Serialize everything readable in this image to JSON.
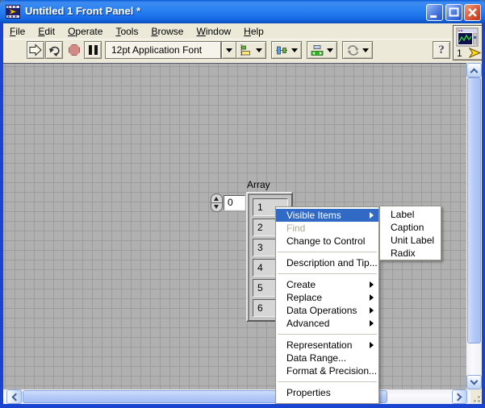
{
  "window": {
    "title": "Untitled 1 Front Panel *"
  },
  "menu_bar": {
    "items": [
      {
        "label": "File"
      },
      {
        "label": "Edit"
      },
      {
        "label": "Operate"
      },
      {
        "label": "Tools"
      },
      {
        "label": "Browse"
      },
      {
        "label": "Window"
      },
      {
        "label": "Help"
      }
    ]
  },
  "toolbar": {
    "font_selector": {
      "value": "12pt Application Font"
    },
    "help_label": "?",
    "panel_number": "1"
  },
  "panel": {
    "array": {
      "label": "Array",
      "index_value": "0",
      "elements": [
        "1",
        "2",
        "3",
        "4",
        "5",
        "6"
      ]
    }
  },
  "context_menu": {
    "items": [
      {
        "label": "Visible Items",
        "highlighted": true,
        "has_submenu": true
      },
      {
        "label": "Find",
        "disabled": true
      },
      {
        "label": "Change to Control"
      },
      {
        "label": "Description and Tip..."
      },
      {
        "label": "Create",
        "has_submenu": true
      },
      {
        "label": "Replace",
        "has_submenu": true
      },
      {
        "label": "Data Operations",
        "has_submenu": true
      },
      {
        "label": "Advanced",
        "has_submenu": true
      },
      {
        "label": "Representation",
        "has_submenu": true
      },
      {
        "label": "Data Range..."
      },
      {
        "label": "Format & Precision..."
      },
      {
        "label": "Properties"
      }
    ],
    "submenu": {
      "items": [
        "Label",
        "Caption",
        "Unit Label",
        "Radix"
      ]
    }
  },
  "colors": {
    "selection_blue": "#316AC5",
    "panel_gray": "#b0b0b0",
    "grid_line": "#9c9c9c",
    "disabled_text": "#aca899",
    "window_border_blue": "#1844cf"
  }
}
